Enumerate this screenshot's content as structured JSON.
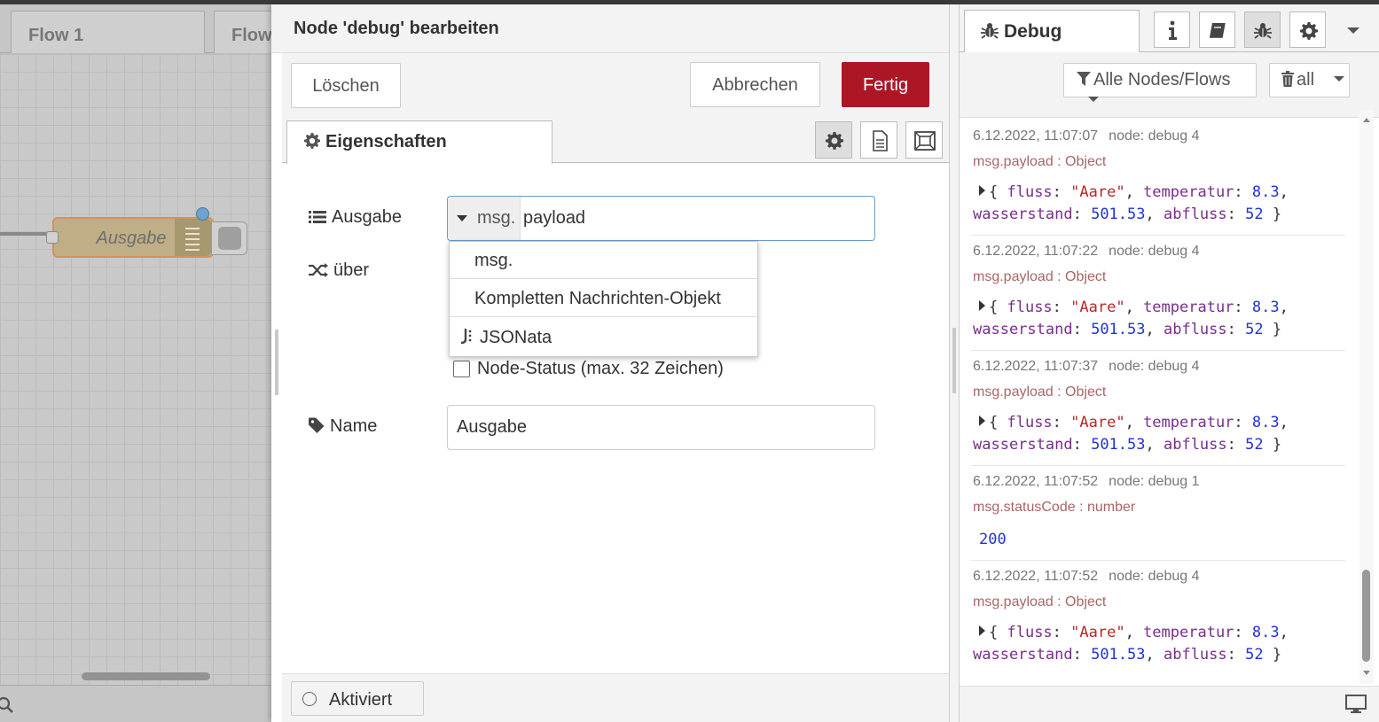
{
  "workspace": {
    "tabs": [
      {
        "label": "Flow 1"
      },
      {
        "label": "Flow"
      }
    ],
    "node": {
      "label": "Ausgabe"
    }
  },
  "tray": {
    "title": "Node 'debug' bearbeiten",
    "buttons": {
      "delete": "Löschen",
      "cancel": "Abbrechen",
      "done": "Fertig"
    },
    "tabs": {
      "properties": "Eigenschaften"
    },
    "fields": {
      "output_label": "Ausgabe",
      "output_type": "msg.",
      "output_value": "payload",
      "to_label": "über",
      "status_checkbox_label": "Node-Status (max. 32 Zeichen)",
      "name_label": "Name",
      "name_value": "Ausgabe"
    },
    "dropdown": {
      "options": [
        "msg.",
        "Kompletten Nachrichten-Objekt",
        "JSONata"
      ]
    },
    "footer": {
      "enabled_label": "Aktiviert"
    }
  },
  "sidebar": {
    "tab_label": "Debug",
    "filter_label": "Alle Nodes/Flows",
    "clear_label": "all",
    "messages": [
      {
        "time": "6.12.2022, 11:07:07",
        "node": "node: debug 4",
        "topic": "msg.payload : Object",
        "fluss": "\"Aare\"",
        "temperatur": "8.3",
        "wasserstand": "501.53",
        "abfluss": "52"
      },
      {
        "time": "6.12.2022, 11:07:22",
        "node": "node: debug 4",
        "topic": "msg.payload : Object",
        "fluss": "\"Aare\"",
        "temperatur": "8.3",
        "wasserstand": "501.53",
        "abfluss": "52"
      },
      {
        "time": "6.12.2022, 11:07:37",
        "node": "node: debug 4",
        "topic": "msg.payload : Object",
        "fluss": "\"Aare\"",
        "temperatur": "8.3",
        "wasserstand": "501.53",
        "abfluss": "52"
      },
      {
        "time": "6.12.2022, 11:07:52",
        "node": "node: debug 1",
        "topic": "msg.statusCode : number",
        "value": "200"
      },
      {
        "time": "6.12.2022, 11:07:52",
        "node": "node: debug 4",
        "topic": "msg.payload : Object",
        "fluss": "\"Aare\"",
        "temperatur": "8.3",
        "wasserstand": "501.53",
        "abfluss": "52"
      }
    ]
  },
  "colors": {
    "done_button": "#ad1625",
    "accent_blue": "#6a9acb",
    "topic_text": "#a66"
  },
  "icons": [
    "search-icon",
    "list-icon",
    "shuffle-icon",
    "tag-icon",
    "gear-icon",
    "file-text-icon",
    "window-icon",
    "bug-icon",
    "info-icon",
    "book-icon",
    "filter-icon",
    "trash-icon",
    "caret-down-icon",
    "jsonata-icon",
    "monitor-icon"
  ]
}
